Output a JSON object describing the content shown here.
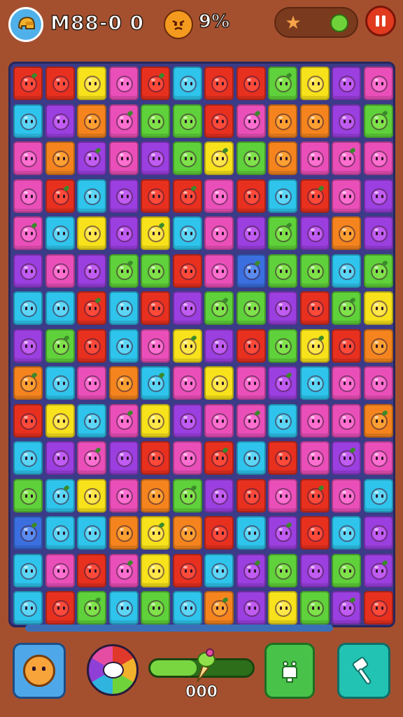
{
  "header": {
    "score_text": "M88-0 0",
    "percent_text": "9%"
  },
  "icons": {
    "avatar": "helmet-avatar-icon",
    "mood": "angry-face-icon",
    "star": "star-booster-icon",
    "gem": "green-gem-icon",
    "pause": "pause-icon",
    "lion": "lion-booster-icon",
    "wheel": "color-wheel-booster-icon",
    "rocket": "rocket-icon",
    "hand": "hand-booster-icon",
    "hammer": "hammer-booster-icon"
  },
  "colors": {
    "R": "#e8301f",
    "O": "#f5841e",
    "Y": "#f7e21b",
    "G": "#5fd13a",
    "C": "#2ec4ec",
    "B": "#3b6fe0",
    "P": "#9b3fe0",
    "M": "#ea4fb9"
  },
  "candy_colors": {
    "R": "#ff4a3a",
    "O": "#ffa032",
    "Y": "#ffe74a",
    "G": "#7fe24a",
    "C": "#5dd6f6",
    "B": "#5a8cf0",
    "P": "#c05cf2",
    "M": "#ff6fd0"
  },
  "board": {
    "rows": [
      "RRYMRCRRGYPM",
      "CPOMGGRMOOPG",
      "MOPMPGYGOMMM",
      "MRCPRRMRCRMP",
      "MCYPYCMPGPOP",
      "PMPGGRMBGGCG",
      "CCRCRPGGPRGY",
      "PGRCMYPRGYRO",
      "OCMOCMYMPCMM",
      "RYCMYPMMCMMO",
      "CPMPRMRCRMPM",
      "GCYMOGPRMRMC",
      "BCCOYORCPRCP",
      "CMRMYRCPGPGP",
      "CRGCGCOPYGPR"
    ]
  },
  "footer": {
    "progress_value": 0.45,
    "progress_text": "000"
  }
}
